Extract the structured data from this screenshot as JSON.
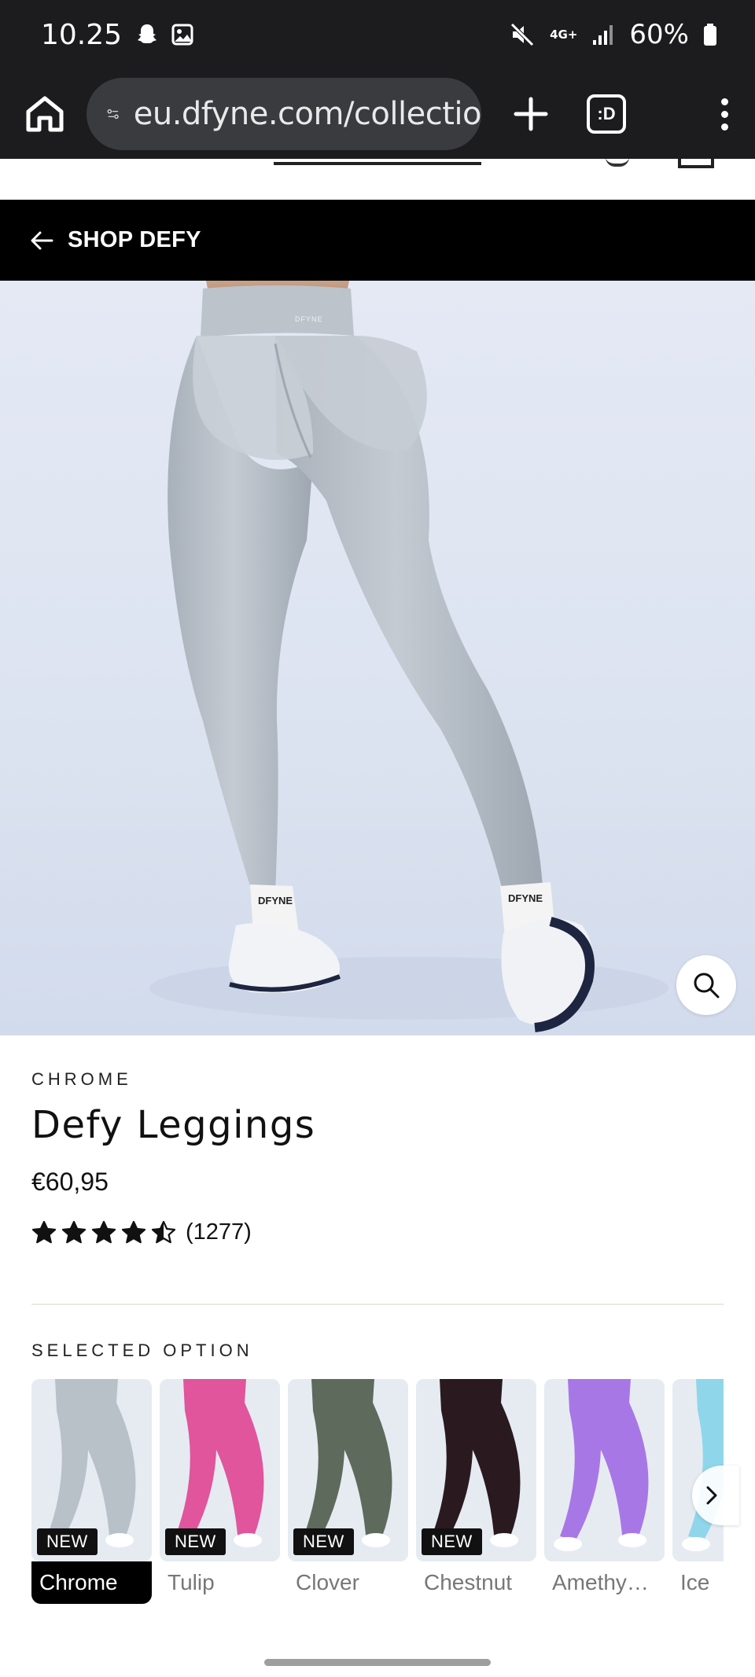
{
  "status_bar": {
    "time": "10.25",
    "network": "4G+",
    "battery": "60%",
    "icons": [
      "snapchat-icon",
      "gallery-icon",
      "mute-icon",
      "signal-icon",
      "battery-icon"
    ]
  },
  "browser": {
    "url": "eu.dfyne.com/collectio",
    "tab_label": ":D",
    "icons": [
      "home-icon",
      "site-settings-icon",
      "new-tab-icon",
      "tabs-icon",
      "more-menu-icon"
    ]
  },
  "breadcrumb": {
    "label": "SHOP DEFY",
    "icon": "arrow-left-icon"
  },
  "product": {
    "colorway": "CHROME",
    "title": "Defy Leggings",
    "price": "€60,95",
    "rating_value": 4.5,
    "rating_max": 5,
    "review_count": "(1277)"
  },
  "options": {
    "label": "SELECTED OPTION",
    "swatches": [
      {
        "name": "Chrome",
        "badge": "NEW",
        "color": "#b8c0c8",
        "selected": true
      },
      {
        "name": "Tulip",
        "badge": "NEW",
        "color": "#e0559c",
        "selected": false
      },
      {
        "name": "Clover",
        "badge": "NEW",
        "color": "#5e6a5c",
        "selected": false
      },
      {
        "name": "Chestnut",
        "badge": "NEW",
        "color": "#2a1a1f",
        "selected": false
      },
      {
        "name": "Amethy…",
        "badge": "",
        "color": "#a877e6",
        "selected": false
      },
      {
        "name": "Ice",
        "badge": "",
        "color": "#8fd6ea",
        "selected": false
      }
    ]
  },
  "colors": {
    "browser_chrome": "#1c1c1e",
    "url_box": "#3a3b3f",
    "shop_bar": "#000000",
    "hero_bg": "#dde4f1",
    "leggings": "#b9c1c9",
    "divider": "#ece9e2"
  }
}
